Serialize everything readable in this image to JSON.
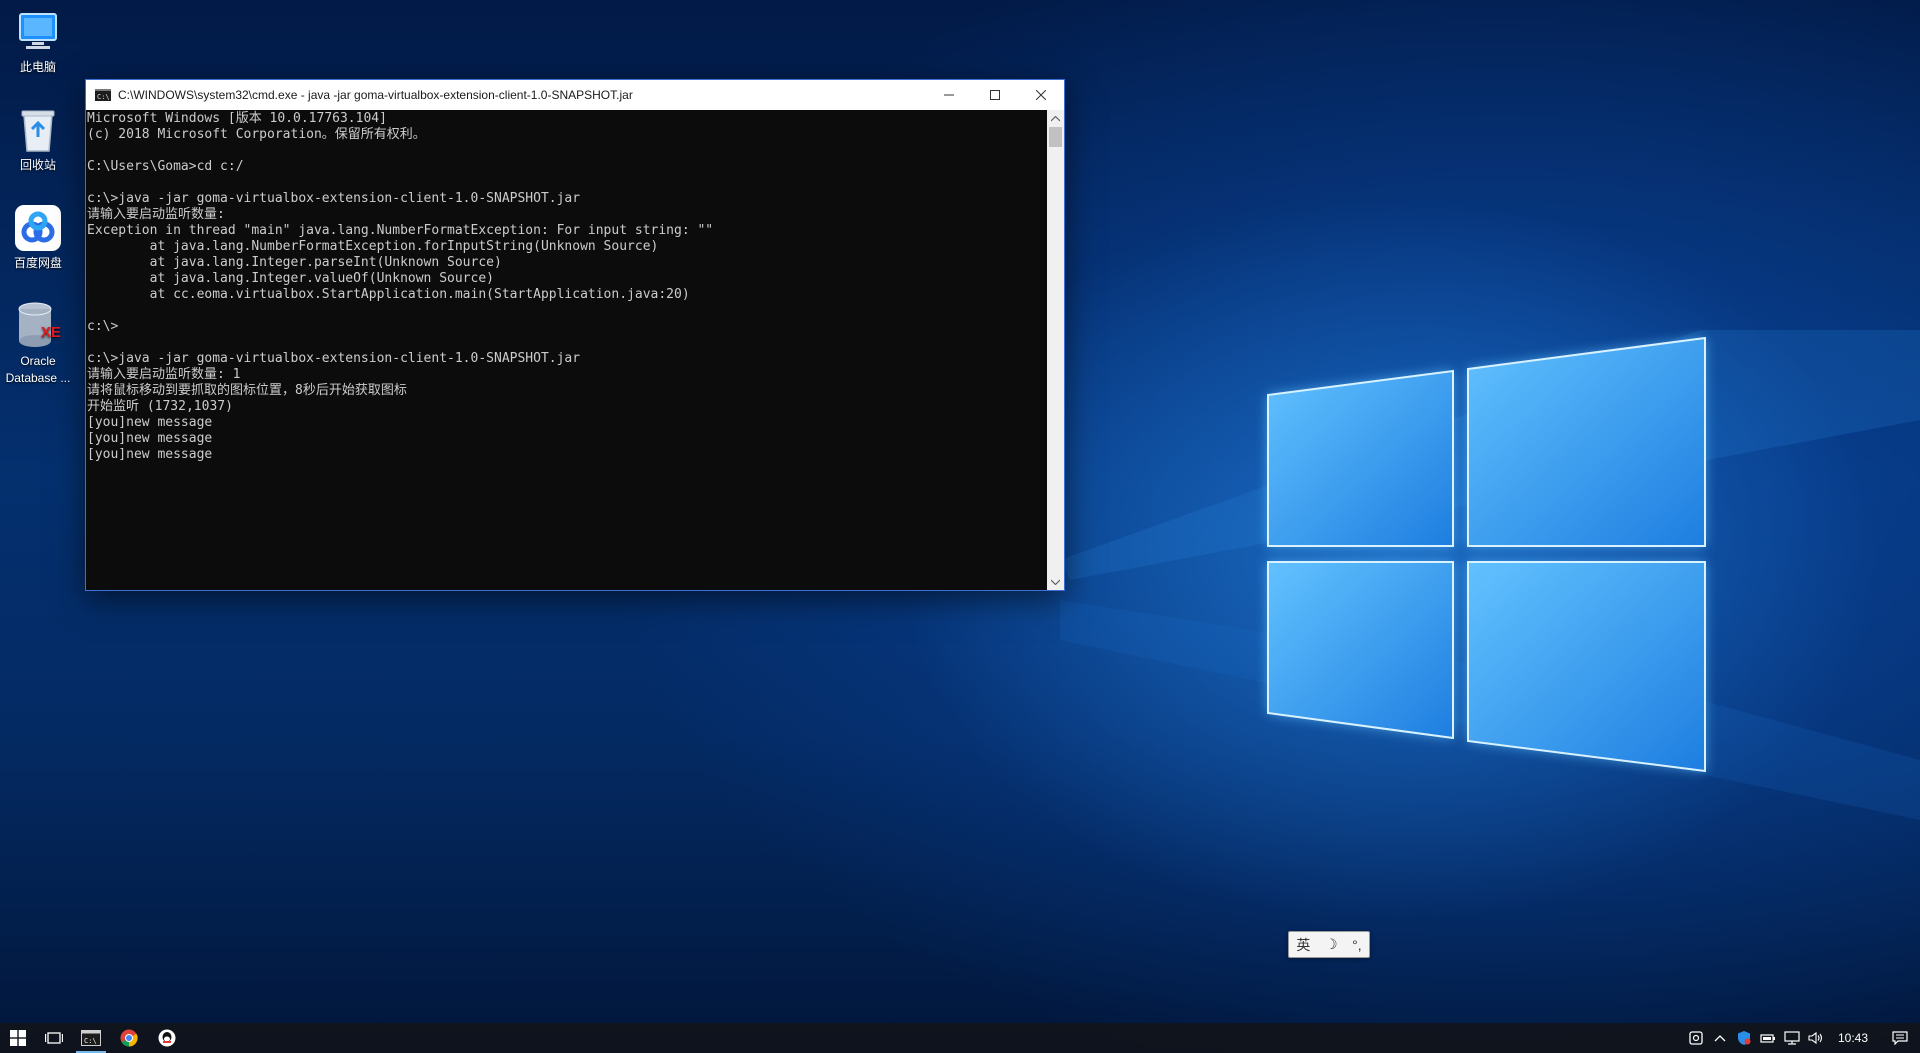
{
  "desktop": {
    "icons": [
      {
        "label": "此电脑",
        "icon": "computer-icon"
      },
      {
        "label": "回收站",
        "icon": "recycle-bin-icon"
      },
      {
        "label": "百度网盘",
        "icon": "baidu-netdisk-icon"
      },
      {
        "label": "Oracle\nDatabase ...",
        "icon": "oracle-database-icon"
      }
    ]
  },
  "cmd_window": {
    "title": "C:\\WINDOWS\\system32\\cmd.exe - java  -jar goma-virtualbox-extension-client-1.0-SNAPSHOT.jar",
    "lines": [
      "Microsoft Windows [版本 10.0.17763.104]",
      "(c) 2018 Microsoft Corporation。保留所有权利。",
      "",
      "C:\\Users\\Goma>cd c:/",
      "",
      "c:\\>java -jar goma-virtualbox-extension-client-1.0-SNAPSHOT.jar",
      "请输入要启动监听数量:",
      "Exception in thread \"main\" java.lang.NumberFormatException: For input string: \"\"",
      "        at java.lang.NumberFormatException.forInputString(Unknown Source)",
      "        at java.lang.Integer.parseInt(Unknown Source)",
      "        at java.lang.Integer.valueOf(Unknown Source)",
      "        at cc.eoma.virtualbox.StartApplication.main(StartApplication.java:20)",
      "",
      "c:\\>",
      "",
      "c:\\>java -jar goma-virtualbox-extension-client-1.0-SNAPSHOT.jar",
      "请输入要启动监听数量: 1",
      "请将鼠标移动到要抓取的图标位置，8秒后开始获取图标",
      "开始监听 (1732,1037)",
      "[you]new message",
      "[you]new message",
      "[you]new message"
    ]
  },
  "ime_bar": {
    "language": "英",
    "mode": "☽",
    "punct": "°,"
  },
  "taskbar": {
    "apps": [
      "cmd-app-icon",
      "chrome-app-icon",
      "qq-app-icon"
    ],
    "clock": "10:43"
  },
  "colors": {
    "console_bg": "#0c0c0c",
    "console_text": "#cccccc",
    "taskbar_bg": "#10141c",
    "accent": "#76b9ed"
  }
}
